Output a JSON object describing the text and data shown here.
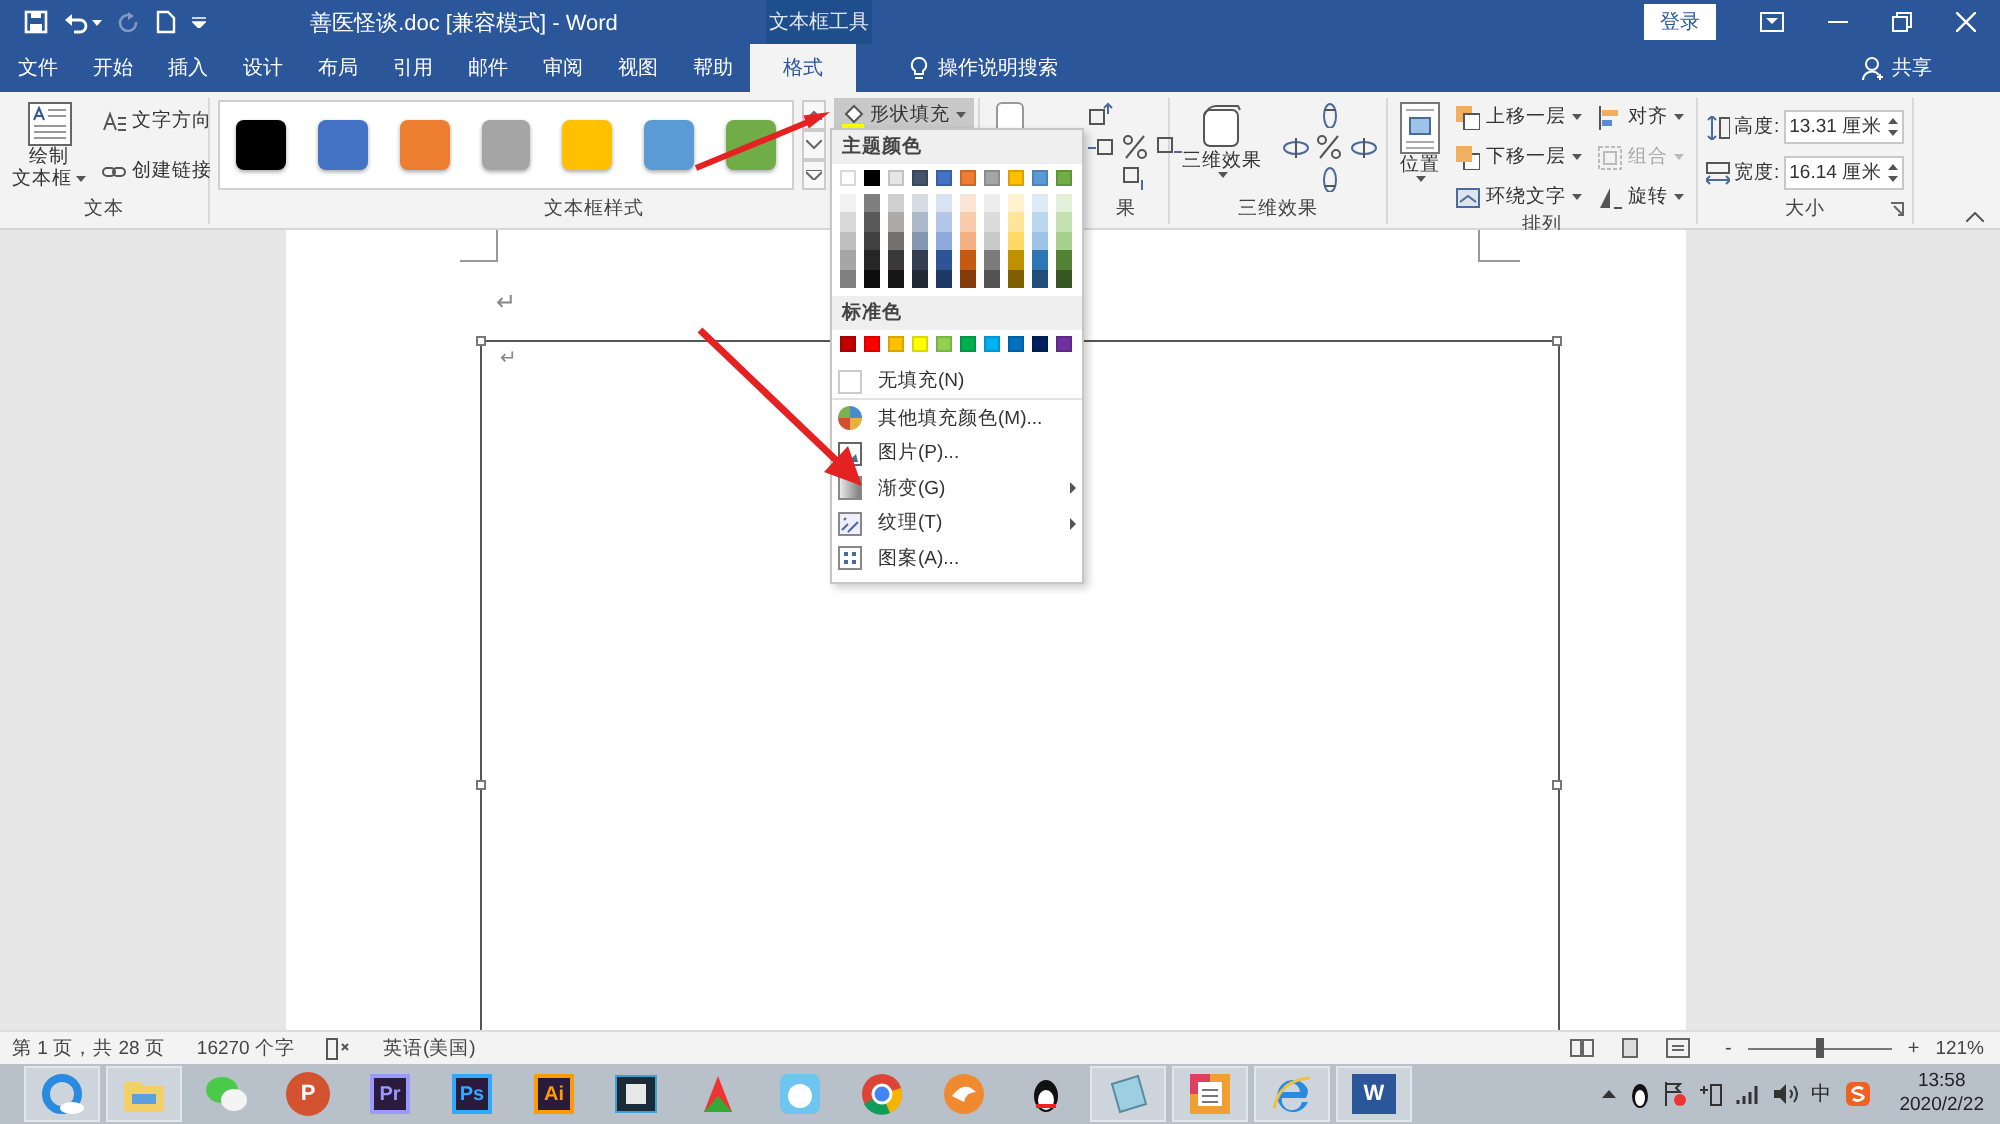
{
  "title_bar": {
    "document_title": "善医怪谈.doc [兼容模式]  -  Word",
    "contextual_group": "文本框工具",
    "sign_in": "登录",
    "redo_disabled": true
  },
  "tabs": [
    {
      "label": "文件",
      "selected": false
    },
    {
      "label": "开始",
      "selected": false
    },
    {
      "label": "插入",
      "selected": false
    },
    {
      "label": "设计",
      "selected": false
    },
    {
      "label": "布局",
      "selected": false
    },
    {
      "label": "引用",
      "selected": false
    },
    {
      "label": "邮件",
      "selected": false
    },
    {
      "label": "审阅",
      "selected": false
    },
    {
      "label": "视图",
      "selected": false
    },
    {
      "label": "帮助",
      "selected": false
    },
    {
      "label": "格式",
      "selected": true
    }
  ],
  "tell_me": "操作说明搜索",
  "share": "共享",
  "ribbon": {
    "groups": [
      {
        "kind": "text",
        "label": "文本",
        "draw_textbox": [
          "绘制",
          "文本框"
        ],
        "small_buttons": [
          {
            "label": "文字方向"
          },
          {
            "label": "创建链接"
          }
        ]
      },
      {
        "kind": "styles",
        "label": "文本框样式",
        "swatches": [
          {
            "color": "#000000"
          },
          {
            "color": "#4472c4"
          },
          {
            "color": "#ed7d31"
          },
          {
            "color": "#a5a5a5"
          },
          {
            "color": "#ffc000"
          },
          {
            "color": "#5b9bd5"
          },
          {
            "color": "#70ad47"
          }
        ],
        "shape_fill": {
          "label": "形状填充",
          "pressed": true
        }
      },
      {
        "kind": "shadow",
        "label": "果"
      },
      {
        "kind": "threed",
        "label": "三维效果",
        "button": "三维效果"
      },
      {
        "kind": "arrange",
        "label": "排列",
        "position": "位置",
        "items": [
          {
            "label": "上移一层",
            "disabled": false
          },
          {
            "label": "下移一层",
            "disabled": false
          },
          {
            "label": "环绕文字",
            "disabled": false
          },
          {
            "label": "对齐",
            "disabled": false
          },
          {
            "label": "组合",
            "disabled": true
          },
          {
            "label": "旋转",
            "disabled": false
          }
        ]
      },
      {
        "kind": "size",
        "label": "大小",
        "fields": [
          {
            "label": "高度:",
            "value": "13.31 厘米"
          },
          {
            "label": "宽度:",
            "value": "16.14 厘米"
          }
        ]
      }
    ]
  },
  "fill_menu": {
    "theme_heading": "主题颜色",
    "theme_colors": [
      {
        "color": "#ffffff",
        "shades": [
          {
            "color": "#f2f2f2"
          },
          {
            "color": "#d9d9d9"
          },
          {
            "color": "#bfbfbf"
          },
          {
            "color": "#a6a6a6"
          },
          {
            "color": "#808080"
          }
        ]
      },
      {
        "color": "#000000",
        "shades": [
          {
            "color": "#7f7f7f"
          },
          {
            "color": "#595959"
          },
          {
            "color": "#404040"
          },
          {
            "color": "#262626"
          },
          {
            "color": "#0d0d0d"
          }
        ]
      },
      {
        "color": "#e7e6e6",
        "shades": [
          {
            "color": "#d0cece"
          },
          {
            "color": "#aeaaaa"
          },
          {
            "color": "#757171"
          },
          {
            "color": "#3a3838"
          },
          {
            "color": "#161616"
          }
        ]
      },
      {
        "color": "#44546a",
        "shades": [
          {
            "color": "#d6dce4"
          },
          {
            "color": "#adb9ca"
          },
          {
            "color": "#8496b0"
          },
          {
            "color": "#333f4f"
          },
          {
            "color": "#222a35"
          }
        ]
      },
      {
        "color": "#4472c4",
        "shades": [
          {
            "color": "#d9e2f3"
          },
          {
            "color": "#b4c6e7"
          },
          {
            "color": "#8eaadb"
          },
          {
            "color": "#2f5496"
          },
          {
            "color": "#1f3864"
          }
        ]
      },
      {
        "color": "#ed7d31",
        "shades": [
          {
            "color": "#fbe5d5"
          },
          {
            "color": "#f7cbac"
          },
          {
            "color": "#f4b183"
          },
          {
            "color": "#c55a11"
          },
          {
            "color": "#843c0c"
          }
        ]
      },
      {
        "color": "#a5a5a5",
        "shades": [
          {
            "color": "#ededed"
          },
          {
            "color": "#dbdbdb"
          },
          {
            "color": "#c9c9c9"
          },
          {
            "color": "#7b7b7b"
          },
          {
            "color": "#525252"
          }
        ]
      },
      {
        "color": "#ffc000",
        "shades": [
          {
            "color": "#fff2cc"
          },
          {
            "color": "#ffe599"
          },
          {
            "color": "#ffd966"
          },
          {
            "color": "#bf9000"
          },
          {
            "color": "#7f6000"
          }
        ]
      },
      {
        "color": "#5b9bd5",
        "shades": [
          {
            "color": "#deebf6"
          },
          {
            "color": "#bdd7ee"
          },
          {
            "color": "#9dc3e6"
          },
          {
            "color": "#2e75b5"
          },
          {
            "color": "#1e4e79"
          }
        ]
      },
      {
        "color": "#70ad47",
        "shades": [
          {
            "color": "#e2efd9"
          },
          {
            "color": "#c5e0b3"
          },
          {
            "color": "#a8d08d"
          },
          {
            "color": "#538135"
          },
          {
            "color": "#375623"
          }
        ]
      }
    ],
    "standard_heading": "标准色",
    "standard_colors": [
      {
        "color": "#c00000"
      },
      {
        "color": "#ff0000"
      },
      {
        "color": "#ffc000"
      },
      {
        "color": "#ffff00"
      },
      {
        "color": "#92d050"
      },
      {
        "color": "#00b050"
      },
      {
        "color": "#00b0f0"
      },
      {
        "color": "#0070c0"
      },
      {
        "color": "#002060"
      },
      {
        "color": "#7030a0"
      }
    ],
    "items": [
      {
        "label": "无填充(N)",
        "submenu": false
      },
      {
        "label": "其他填充颜色(M)...",
        "submenu": false
      },
      {
        "label": "图片(P)...",
        "submenu": false
      },
      {
        "label": "渐变(G)",
        "submenu": true
      },
      {
        "label": "纹理(T)",
        "submenu": true
      },
      {
        "label": "图案(A)...",
        "submenu": false
      }
    ]
  },
  "document": {
    "page_mark": "↵",
    "textbox_mark": "↵"
  },
  "status_bar": {
    "page": "第 1 页，共 28 页",
    "words": "16270 个字",
    "language": "英语(美国)",
    "minus": "-",
    "plus": "+",
    "zoom_slider": {
      "level": 0.5
    },
    "zoom": "121%"
  },
  "taskbar": {
    "apps": [
      {
        "kind": "browser",
        "active": true
      },
      {
        "kind": "folder",
        "active": true
      },
      {
        "kind": "chat",
        "active": false
      },
      {
        "kind": "slides",
        "label": "P",
        "active": false
      },
      {
        "kind": "tile",
        "label": "Pr",
        "color": "#9999ff",
        "active": false
      },
      {
        "kind": "tile",
        "label": "Ps",
        "color": "#31a8ff",
        "active": false
      },
      {
        "kind": "tile",
        "label": "Ai",
        "color": "#ff9a00",
        "active": false
      },
      {
        "kind": "film",
        "active": false
      },
      {
        "kind": "red-app",
        "active": false
      },
      {
        "kind": "cat",
        "active": false
      },
      {
        "kind": "chrome",
        "active": false
      },
      {
        "kind": "fox",
        "active": false
      },
      {
        "kind": "penguin",
        "active": false
      },
      {
        "kind": "notepad",
        "active": true
      },
      {
        "kind": "calendar",
        "active": true
      },
      {
        "kind": "ie",
        "active": true
      },
      {
        "kind": "word",
        "label": "W",
        "active": true
      }
    ],
    "ime": "中",
    "time": "13:58",
    "date": "2020/2/22"
  }
}
